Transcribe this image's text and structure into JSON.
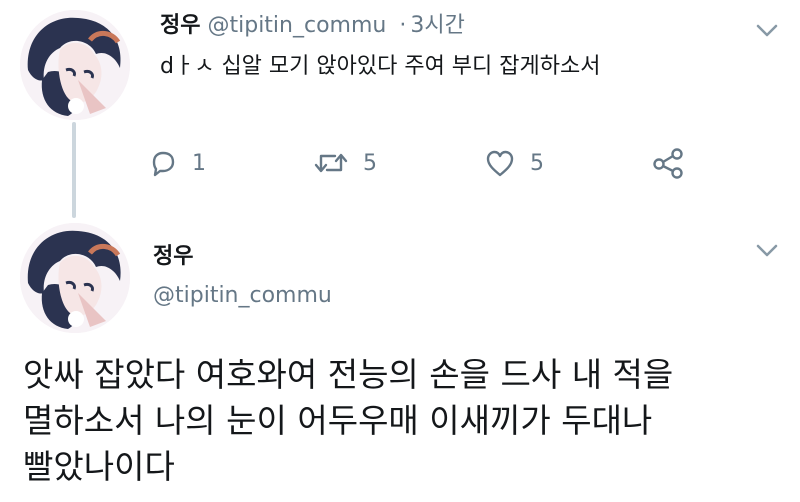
{
  "tweet1": {
    "display_name": "정우",
    "handle": "@tipitin_commu",
    "separator": "·",
    "time": "3시간",
    "text": "dㅏㅅ 십알 모기 앉아있다 주여 부디 잡게하소서",
    "actions": {
      "reply_count": "1",
      "retweet_count": "5",
      "like_count": "5"
    }
  },
  "tweet2": {
    "display_name": "정우",
    "handle": "@tipitin_commu",
    "text_lines": [
      "앗싸 잡았다 여호와여 전능의 손을 드사 내 적을",
      "멸하소서 나의 눈이 어두우매 이새끼가 두대나",
      "빨았나이다"
    ]
  },
  "icons": {
    "reply": "reply-icon",
    "retweet": "retweet-icon",
    "like": "heart-icon",
    "share": "share-icon",
    "more": "chevron-down-icon",
    "avatar": "avatar-image"
  },
  "colors": {
    "text_primary": "#14171a",
    "text_secondary": "#657786",
    "thread_line": "#ccd6dd"
  }
}
